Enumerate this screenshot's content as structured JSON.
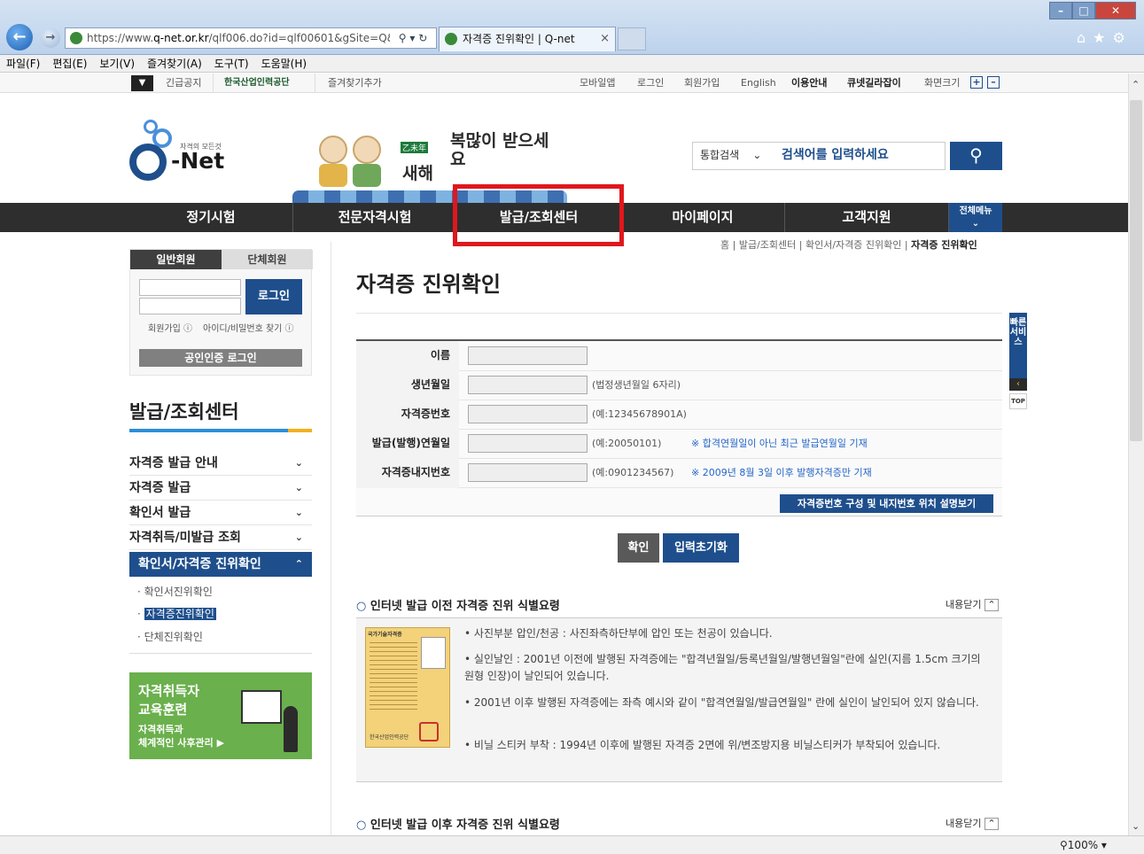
{
  "browser": {
    "url_prefix": "https://www.",
    "url_domain": "q-net.or.kr",
    "url_path": "/qlf006.do?id=qlf00601&gSite=Q&gIc",
    "tab_title": "자격증 진위확인 | Q-net",
    "menu": [
      "파일(F)",
      "편집(E)",
      "보기(V)",
      "즐겨찾기(A)",
      "도구(T)",
      "도움말(H)"
    ],
    "zoom": "100%"
  },
  "util": {
    "notice": "긴급공지",
    "org": "한국산업인력공단",
    "favorite": "즐겨찾기추가",
    "links": [
      "모바일앱",
      "로그인",
      "회원가입",
      "English",
      "이용안내",
      "큐넷길라잡이",
      "화면크기"
    ]
  },
  "header": {
    "logo_tagline": "자격의 모든것",
    "logo_text": "-Net",
    "banner_small": "乙未年",
    "banner_text1": "새해",
    "banner_text2": "복많이 받으세요",
    "search_scope": "통합검색",
    "search_placeholder": "검색어를 입력하세요"
  },
  "gnb": {
    "items": [
      "정기시험",
      "전문자격시험",
      "발급/조회센터",
      "마이페이지",
      "고객지원"
    ],
    "all_menu": "전체메뉴"
  },
  "breadcrumb": [
    "홈",
    "발급/조회센터",
    "확인서/자격증 진위확인",
    "자격증 진위확인"
  ],
  "login": {
    "tab_personal": "일반회원",
    "tab_group": "단체회원",
    "login_button": "로그인",
    "join": "회원가입",
    "find": "아이디/비밀번호 찾기",
    "cert_login": "공인인증 로그인"
  },
  "sidebar": {
    "title": "발급/조회센터",
    "items": [
      "자격증 발급 안내",
      "자격증 발급",
      "확인서 발급",
      "자격취득/미발급 조회",
      "확인서/자격증 진위확인"
    ],
    "subitems": [
      "확인서진위확인",
      "자격증진위확인",
      "단체진위확인"
    ],
    "banner_line1": "자격취득자",
    "banner_line2": "교육훈련",
    "banner_line3": "자격취득과",
    "banner_line4": "체계적인 사후관리"
  },
  "main": {
    "title": "자격증 진위확인",
    "form": [
      {
        "label": "이름",
        "hint": "",
        "note": ""
      },
      {
        "label": "생년월일",
        "hint": "(법정생년월일 6자리)",
        "note": ""
      },
      {
        "label": "자격증번호",
        "hint": "(예:12345678901A)",
        "note": ""
      },
      {
        "label": "발급(발행)연월일",
        "hint": "(예:20050101)",
        "note": "※ 합격연월일이 아닌 최근 발급연월일 기재"
      },
      {
        "label": "자격증내지번호",
        "hint": "(예:0901234567)",
        "note": "※ 2009년 8월 3일 이후 발행자격증만 기재"
      }
    ],
    "explain_button": "자격증번호 구성 및 내지번호 위치 설명보기",
    "confirm_button": "확인",
    "reset_button": "입력초기화",
    "section1_title": "인터넷 발급 이전 자격증 진위 식별요령",
    "section2_title": "인터넷 발급 이후 자격증 진위 식별요령",
    "close_label": "내용닫기",
    "card_header": "국가기술자격증",
    "card_footer": "한국산업인력공단",
    "bullets": [
      "사진부분 압인/천공 : 사진좌측하단부에 압인 또는 천공이 있습니다.",
      "실인날인 : 2001년 이전에 발행된 자격증에는 \"합격년월일/등록년월일/발행년월일\"란에 실인(지름 1.5cm 크기의 원형 인장)이 날인되어 있습니다.",
      "2001년 이후 발행된 자격증에는 좌측 예시와 같이 \"합격연월일/발급연월일\" 란에 실인이 날인되어 있지 않습니다.",
      "비닐 스티커 부착 : 1994년 이후에 발행된 자격증 2면에 위/변조방지용 비닐스티커가 부착되어 있습니다."
    ]
  },
  "quick": {
    "label": "빠른서비스",
    "top": "TOP"
  }
}
